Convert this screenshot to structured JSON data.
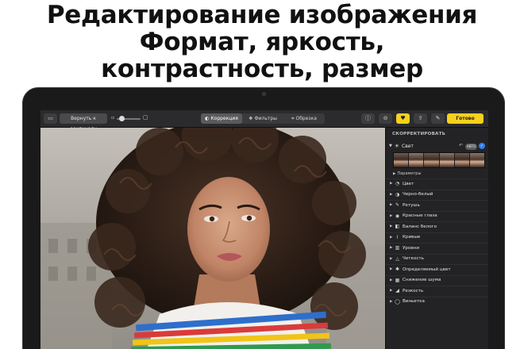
{
  "headline": {
    "line1": "Редактирование изображения",
    "line2": "Формат, яркость,",
    "line3": "контрастность, размер"
  },
  "toolbar": {
    "sidebar_icon": "sidebar-toggle-icon",
    "revert_label": "Вернуть к оригиналу",
    "zoom_small_icon": "zoom-out-icon",
    "zoom_large_icon": "zoom-in-icon",
    "tabs": [
      {
        "label": "Коррекция",
        "icon": "adjust-icon",
        "active": true
      },
      {
        "label": "Фильтры",
        "icon": "filters-icon",
        "active": false
      },
      {
        "label": "Обрезка",
        "icon": "crop-icon",
        "active": false
      }
    ],
    "info_icon": "info-icon",
    "more_icon": "more-icon",
    "favorite_icon": "heart-icon",
    "share_icon": "share-icon",
    "tools_icon": "magic-wand-icon",
    "done_label": "Готово",
    "accent": "#f7d11c"
  },
  "sidebar": {
    "title": "СКОРРЕКТИРОВАТЬ",
    "light": {
      "label": "Свет",
      "icon": "sun-icon",
      "auto_label": "АВТО",
      "check_color": "#2f7cf6"
    },
    "params_label": "Параметры",
    "adjustments": [
      {
        "label": "Цвет",
        "icon": "color-icon"
      },
      {
        "label": "Черно-белый",
        "icon": "bw-icon"
      },
      {
        "label": "Ретушь",
        "icon": "retouch-icon"
      },
      {
        "label": "Красные глаза",
        "icon": "red-eye-icon"
      },
      {
        "label": "Баланс белого",
        "icon": "white-balance-icon"
      },
      {
        "label": "Кривые",
        "icon": "curves-icon"
      },
      {
        "label": "Уровни",
        "icon": "levels-icon"
      },
      {
        "label": "Четкость",
        "icon": "definition-icon"
      },
      {
        "label": "Определяемый цвет",
        "icon": "selective-color-icon"
      },
      {
        "label": "Снижение шума",
        "icon": "noise-reduction-icon"
      },
      {
        "label": "Резкость",
        "icon": "sharpen-icon"
      },
      {
        "label": "Виньетка",
        "icon": "vignette-icon"
      }
    ]
  }
}
